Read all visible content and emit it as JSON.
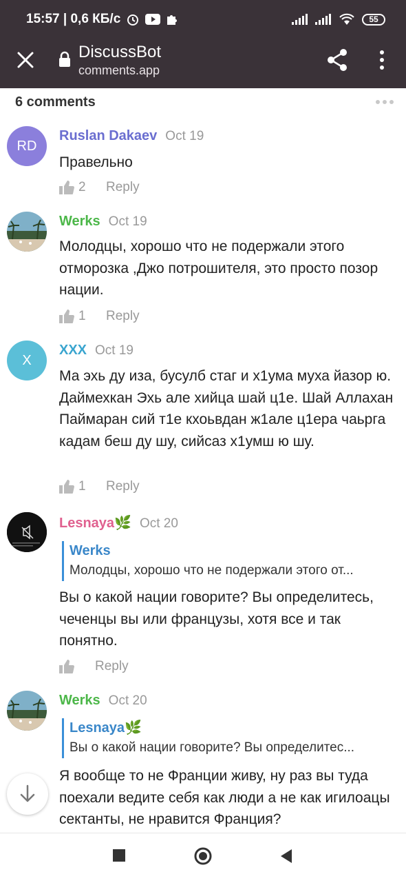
{
  "status_bar": {
    "time_network": "15:57 | 0,6 КБ/с",
    "battery": "55"
  },
  "header": {
    "title": "DiscussBot",
    "url": "comments.app"
  },
  "comments_count": "6 comments",
  "colors": {
    "appbar": "#3a3238",
    "quote_bar": "#3a8fd8",
    "link": "#3a87c9"
  },
  "comments": [
    {
      "avatar_initials": "RD",
      "avatar_color": "#8b7fdc",
      "author": "Ruslan Dakaev",
      "author_color": "#6a6ed0",
      "date": "Oct 19",
      "text": "Правельно",
      "likes": "2",
      "reply": "Reply"
    },
    {
      "avatar_icon": "beach-photo",
      "author": "Werks",
      "author_color": "#4cb749",
      "date": "Oct 19",
      "text": "Молодцы, хорошо что не подержали этого отморозка ,Джо потрошителя, это просто позор нации.",
      "likes": "1",
      "reply": "Reply"
    },
    {
      "avatar_initials": "X",
      "avatar_color": "#5bbfd8",
      "author": "XXX",
      "author_color": "#3aa5cf",
      "date": "Oct 19",
      "text": "Ма эхь ду иза, бусулб стаг и х1ума муха йазор ю. Даймехкан Эхь але хийца шай ц1е. Шай Аллахан Паймаран сий т1е кхоьвдан ж1але ц1ера чаьрга кадам беш ду шу, сийсаз х1умш ю шу.",
      "likes": "1",
      "reply": "Reply"
    },
    {
      "avatar_icon": "muted-video",
      "author": "Lesnaya🌿",
      "author_color": "#e0608f",
      "date": "Oct 20",
      "quote_author": "Werks",
      "quote_text": "Молодцы, хорошо что не подержали этого от...",
      "text": "Вы о какой нации говорите? Вы определитесь, чеченцы вы или французы, хотя все и так понятно.",
      "likes": "",
      "reply": "Reply"
    },
    {
      "avatar_icon": "beach-photo",
      "author": "Werks",
      "author_color": "#4cb749",
      "date": "Oct 20",
      "quote_author": "Lesnaya🌿",
      "quote_text": "Вы о какой нации говорите? Вы определитес...",
      "text": "Я вообще то не Франции живу, ну раз вы туда поехали ведите себя как люди а не как игилоацы сектанты, не нравится Франция?"
    }
  ]
}
